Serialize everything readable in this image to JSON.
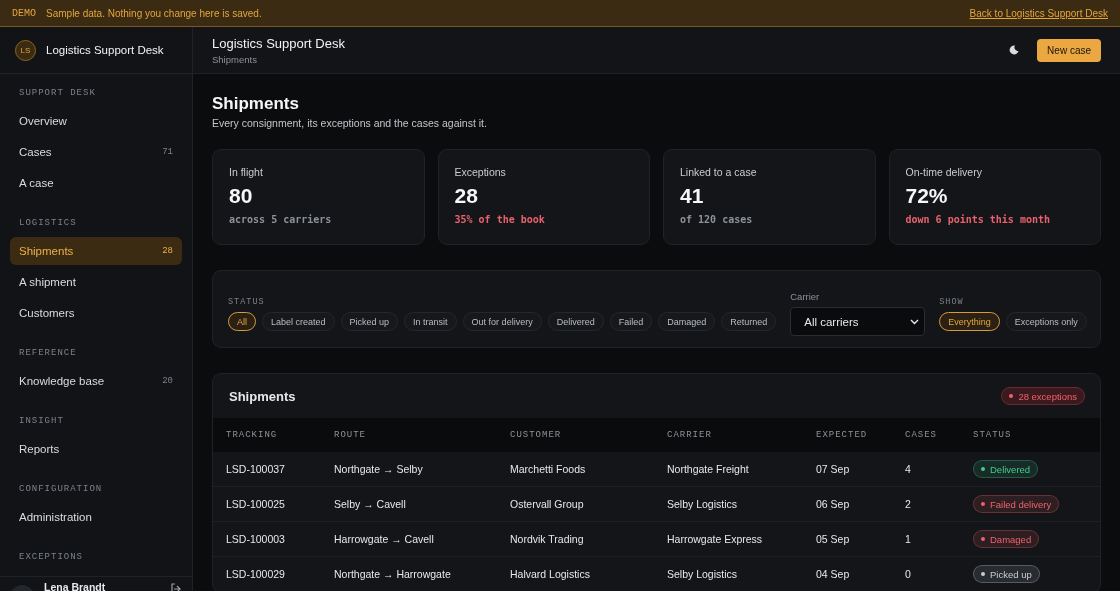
{
  "banner": {
    "tag": "DEMO",
    "message": "Sample data. Nothing you change here is saved.",
    "link": "Back to Logistics Support Desk"
  },
  "brand": {
    "initials": "LS",
    "name": "Logistics Support Desk"
  },
  "sidebar": {
    "sections": [
      {
        "label": "SUPPORT DESK",
        "items": [
          {
            "label": "Overview",
            "selected": false
          },
          {
            "label": "Cases",
            "count": "71",
            "selected": false
          },
          {
            "label": "A case",
            "selected": false
          }
        ]
      },
      {
        "label": "LOGISTICS",
        "items": [
          {
            "label": "Shipments",
            "count": "28",
            "selected": true
          },
          {
            "label": "A shipment",
            "selected": false
          },
          {
            "label": "Customers",
            "selected": false
          }
        ]
      },
      {
        "label": "REFERENCE",
        "items": [
          {
            "label": "Knowledge base",
            "count": "20",
            "selected": false
          }
        ]
      },
      {
        "label": "INSIGHT",
        "items": [
          {
            "label": "Reports",
            "selected": false
          }
        ]
      },
      {
        "label": "CONFIGURATION",
        "items": [
          {
            "label": "Administration",
            "selected": false
          }
        ]
      },
      {
        "label": "EXCEPTIONS"
      }
    ],
    "user": {
      "name": "Lena Brandt"
    }
  },
  "header": {
    "title": "Logistics Support Desk",
    "breadcrumb": "Shipments",
    "button": "New case"
  },
  "page": {
    "title": "Shipments",
    "subtitle": "Every consignment, its exceptions and the cases against it."
  },
  "stats": [
    {
      "label": "In flight",
      "value": "80",
      "note": "across 5 carriers",
      "color": "#8d9299"
    },
    {
      "label": "Exceptions",
      "value": "28",
      "note": "35% of the book",
      "color": "#e8626e"
    },
    {
      "label": "Linked to a case",
      "value": "41",
      "note": "of 120 cases",
      "color": "#8d9299"
    },
    {
      "label": "On-time delivery",
      "value": "72%",
      "note": "down 6 points this month",
      "color": "#e8626e"
    }
  ],
  "filters": {
    "status_label": "STATUS",
    "statuses": [
      {
        "label": "All",
        "selected": true
      },
      {
        "label": "Label created",
        "selected": false
      },
      {
        "label": "Picked up",
        "selected": false
      },
      {
        "label": "In transit",
        "selected": false
      },
      {
        "label": "Out for delivery",
        "selected": false
      },
      {
        "label": "Delivered",
        "selected": false
      },
      {
        "label": "Failed",
        "selected": false
      },
      {
        "label": "Damaged",
        "selected": false
      },
      {
        "label": "Returned",
        "selected": false
      }
    ],
    "carrier_label": "Carrier",
    "carrier_value": "All carriers",
    "show_label": "SHOW",
    "show": [
      {
        "label": "Everything",
        "selected": true
      },
      {
        "label": "Exceptions only",
        "selected": false
      }
    ]
  },
  "table": {
    "title": "Shipments",
    "badge": "28 exceptions",
    "columns": [
      "TRACKING",
      "ROUTE",
      "CUSTOMER",
      "CARRIER",
      "EXPECTED",
      "CASES",
      "STATUS"
    ],
    "rows": [
      {
        "tracking": "LSD-100037",
        "route": "Northgate → Selby",
        "customer": "Marchetti Foods",
        "carrier": "Northgate Freight",
        "expected": "07 Sep",
        "cases": "4",
        "status": "Delivered",
        "color": "#3ecf8e"
      },
      {
        "tracking": "LSD-100025",
        "route": "Selby → Cavell",
        "customer": "Ostervall Group",
        "carrier": "Selby Logistics",
        "expected": "06 Sep",
        "cases": "2",
        "status": "Failed delivery",
        "color": "#f0616d"
      },
      {
        "tracking": "LSD-100003",
        "route": "Harrowgate → Cavell",
        "customer": "Nordvik Trading",
        "carrier": "Harrowgate Express",
        "expected": "05 Sep",
        "cases": "1",
        "status": "Damaged",
        "color": "#f0616d"
      },
      {
        "tracking": "LSD-100029",
        "route": "Northgate → Harrowgate",
        "customer": "Halvard Logistics",
        "carrier": "Selby Logistics",
        "expected": "04 Sep",
        "cases": "0",
        "status": "Picked up",
        "color": "#c9cdd2"
      }
    ]
  }
}
